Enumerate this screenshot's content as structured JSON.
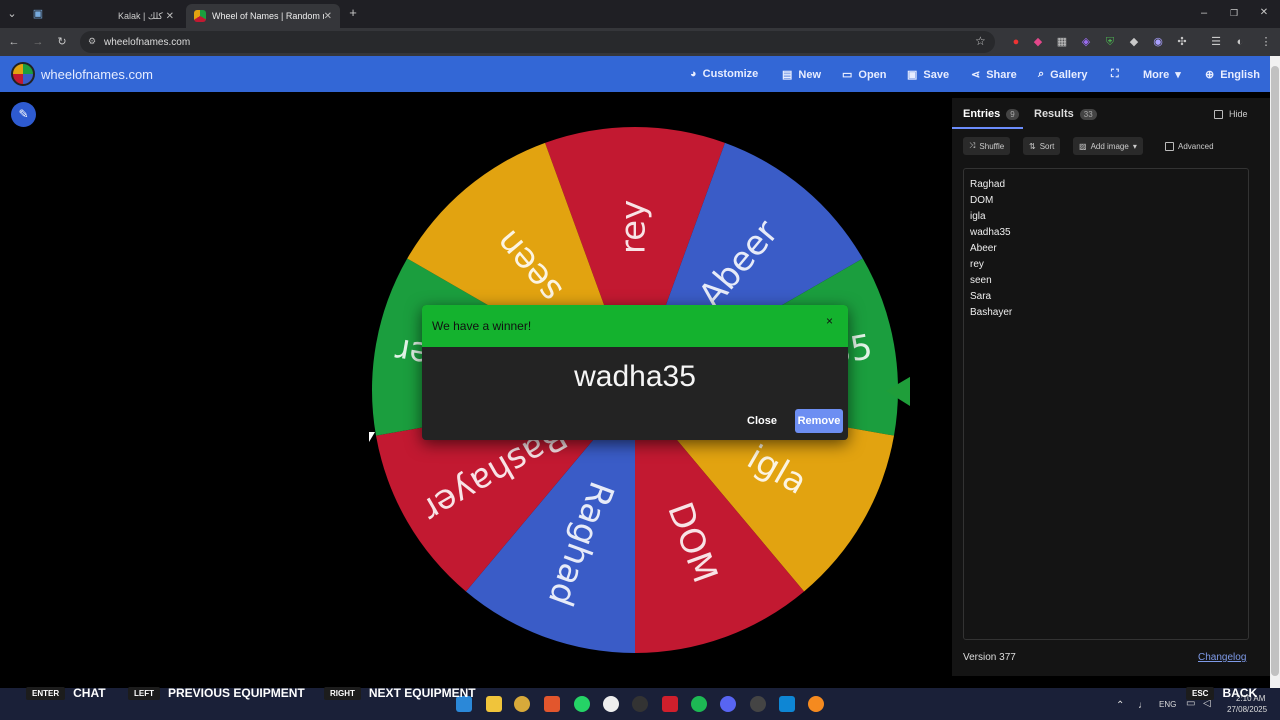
{
  "browser": {
    "tabs": [
      {
        "title": "Kalak | كلك",
        "active": false
      },
      {
        "title": "Wheel of Names | Random nam",
        "active": true
      }
    ],
    "new_tab": "+",
    "url": "wheelofnames.com",
    "window_controls": [
      "–",
      "❐",
      "✕"
    ]
  },
  "app": {
    "logo_text": "wheelofnames.com",
    "nav": [
      {
        "label": "Customize",
        "icon": "palette-icon",
        "glyph": "◕"
      },
      {
        "label": "New",
        "icon": "file-icon",
        "glyph": "▤"
      },
      {
        "label": "Open",
        "icon": "folder-icon",
        "glyph": "▭"
      },
      {
        "label": "Save",
        "icon": "save-icon",
        "glyph": "▣"
      },
      {
        "label": "Share",
        "icon": "share-icon",
        "glyph": "⋖"
      },
      {
        "label": "Gallery",
        "icon": "search-icon",
        "glyph": "⌕"
      },
      {
        "label": "",
        "icon": "fullscreen-icon",
        "glyph": "⛶"
      },
      {
        "label": "More",
        "icon": "chevron-down-icon",
        "glyph": "▾"
      },
      {
        "label": "English",
        "icon": "globe-icon",
        "glyph": "⊕"
      }
    ]
  },
  "wheel": {
    "segments": [
      {
        "label": "rey",
        "color": "#c21931"
      },
      {
        "label": "Abeer",
        "color": "#3a5cc7"
      },
      {
        "label": "wadha35",
        "color": "#1b9e3e"
      },
      {
        "label": "igla",
        "color": "#e2a310"
      },
      {
        "label": "DOM",
        "color": "#c21931"
      },
      {
        "label": "Raghad",
        "color": "#3a5cc7"
      },
      {
        "label": "Bashayer",
        "color": "#c21931"
      },
      {
        "label": "Bashayer",
        "color": "#1b9e3e"
      },
      {
        "label": "seen",
        "color": "#e2a310"
      }
    ],
    "pointer_color": "#1f9e3a"
  },
  "panel": {
    "entries_tab": "Entries",
    "entries_count": "9",
    "results_tab": "Results",
    "results_count": "33",
    "hide_label": "Hide",
    "tools": {
      "shuffle": "Shuffle",
      "sort": "Sort",
      "add_image": "Add image",
      "advanced": "Advanced"
    },
    "entries": [
      "Raghad",
      "DOM",
      "igla",
      "wadha35",
      "Abeer",
      "rey",
      "seen",
      "Sara",
      "Bashayer"
    ],
    "version": "Version 377",
    "changelog": "Changelog"
  },
  "dialog": {
    "title": "We have a winner!",
    "close_x": "×",
    "winner": "wadha35",
    "close_button": "Close",
    "remove_button": "Remove"
  },
  "overlay_hints": [
    {
      "key": "ENTER",
      "label": "CHAT"
    },
    {
      "key": "LEFT",
      "label": "PREVIOUS EQUIPMENT"
    },
    {
      "key": "RIGHT",
      "label": "NEXT EQUIPMENT"
    },
    {
      "key": "ESC",
      "label": "BACK"
    }
  ],
  "tray": {
    "language": "ENG",
    "time": "2:10 AM",
    "date": "27/08/2025"
  }
}
